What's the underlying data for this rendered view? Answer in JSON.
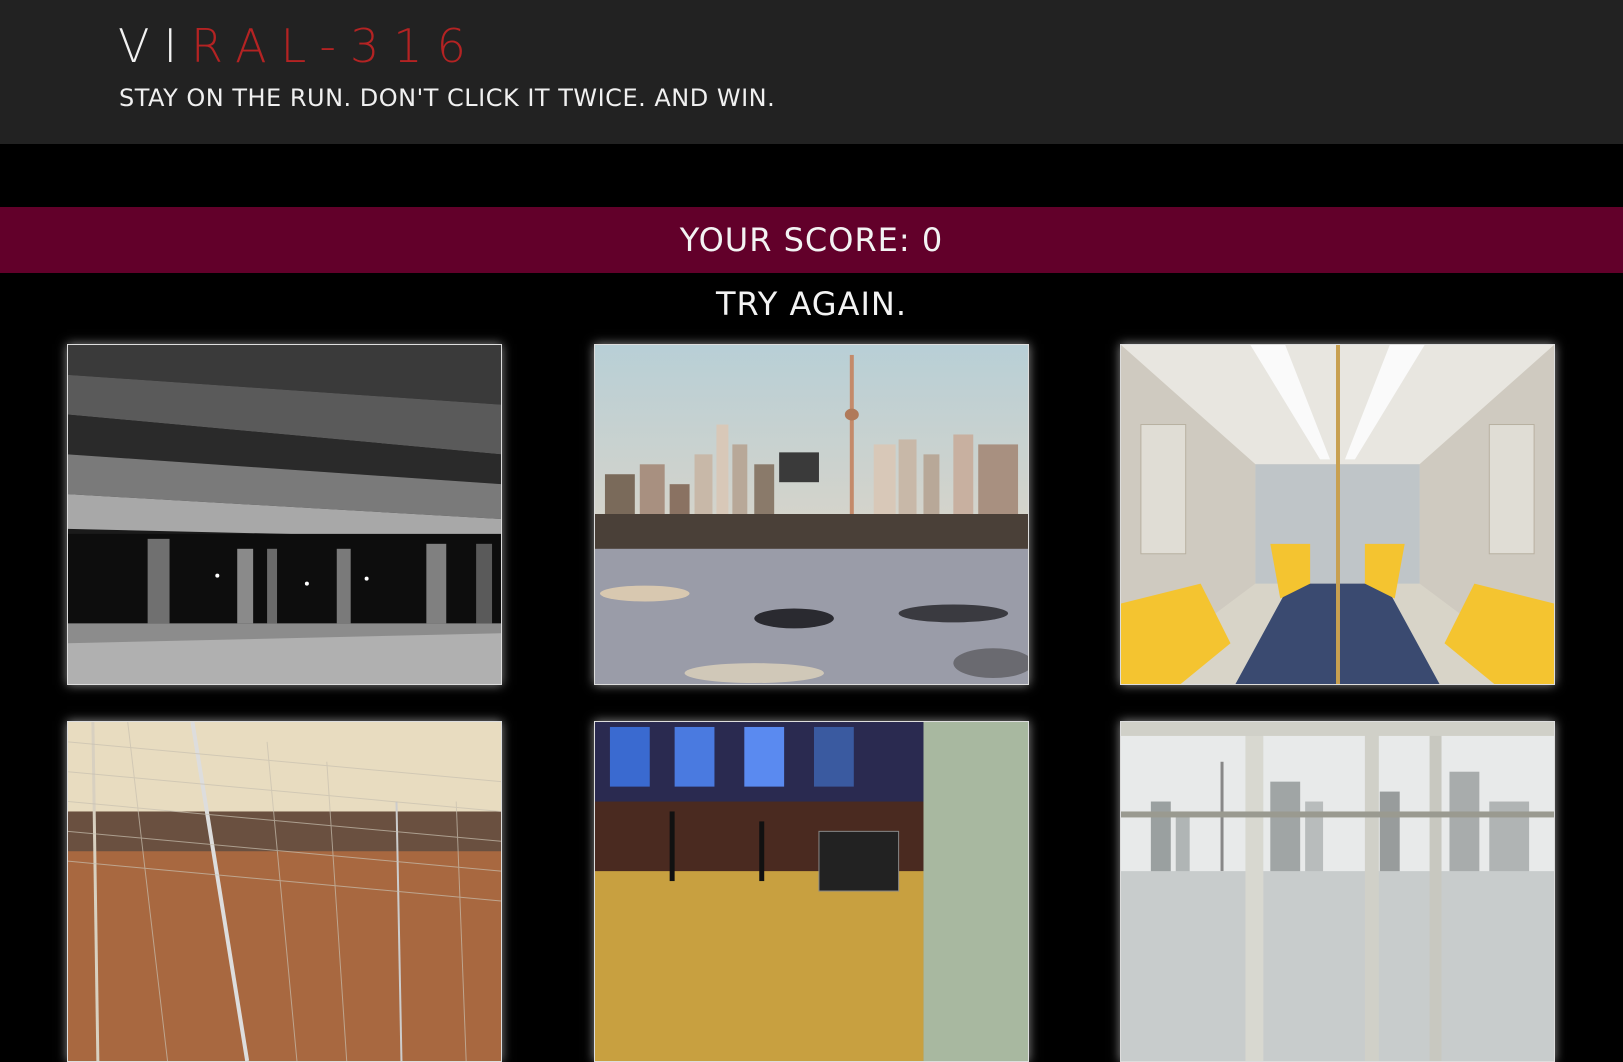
{
  "header": {
    "title_white": "VI",
    "title_red": "RAL-316",
    "tagline": "STAY ON THE RUN. DON'T CLICK IT TWICE. AND WIN."
  },
  "score": {
    "label": "YOUR SCORE: 0"
  },
  "message": "TRY AGAIN.",
  "colors": {
    "header_bg": "#222222",
    "page_bg": "#000000",
    "score_bar_bg": "#62002a",
    "title_accent": "#b42323"
  },
  "cards": [
    {
      "name": "parking-garage-image"
    },
    {
      "name": "city-skyline-image"
    },
    {
      "name": "subway-car-image"
    },
    {
      "name": "soccer-goal-image"
    },
    {
      "name": "street-night-image"
    },
    {
      "name": "window-city-view-image"
    }
  ]
}
